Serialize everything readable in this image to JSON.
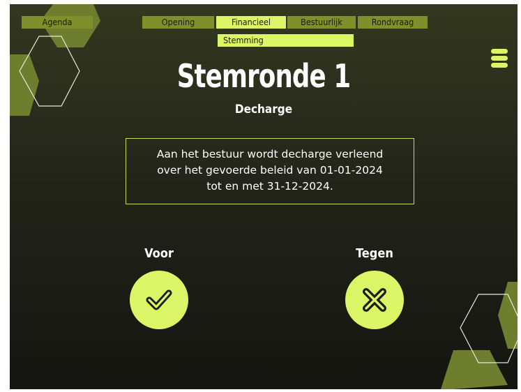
{
  "nav": {
    "tabs": [
      {
        "label": "Agenda",
        "active": false
      },
      {
        "label": "Opening",
        "active": false
      },
      {
        "label": "Financieel",
        "active": true
      },
      {
        "label": "Bestuurlijk",
        "active": false
      },
      {
        "label": "Rondvraag",
        "active": false
      }
    ],
    "subtab": {
      "label": "Stemming",
      "active": true
    }
  },
  "menu_icon": "hamburger-menu-icon",
  "page": {
    "title": "Stemronde 1",
    "subtitle": "Decharge"
  },
  "statement": {
    "lines": [
      "Aan het bestuur wordt decharge verleend",
      "over het gevoerde beleid van 01-01-2024",
      "tot en met 31-12-2024."
    ]
  },
  "vote": {
    "for": {
      "label": "Voor",
      "icon": "checkmark-icon"
    },
    "against": {
      "label": "Tegen",
      "icon": "cross-icon"
    }
  },
  "colors": {
    "accent": "#dcf566",
    "tab_inactive": "#7f8f2b",
    "background_top": "#34381f",
    "background_bottom": "#141510"
  }
}
